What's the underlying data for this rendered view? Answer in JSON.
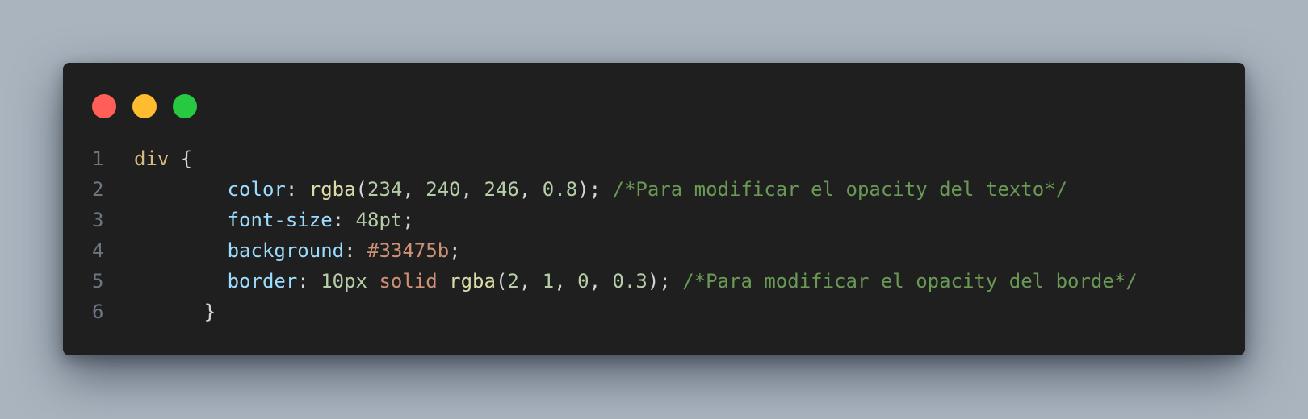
{
  "window": {
    "traffic_lights": [
      {
        "name": "close",
        "color": "#ff5f57"
      },
      {
        "name": "minimize",
        "color": "#febc2e"
      },
      {
        "name": "maximize",
        "color": "#28c840"
      }
    ]
  },
  "code": {
    "lines": [
      {
        "number": "1",
        "indent": "",
        "tokens": [
          {
            "type": "selector",
            "text": "div"
          },
          {
            "type": "brace",
            "text": " {"
          }
        ]
      },
      {
        "number": "2",
        "indent": "        ",
        "tokens": [
          {
            "type": "prop",
            "text": "color"
          },
          {
            "type": "punct",
            "text": ": "
          },
          {
            "type": "func",
            "text": "rgba"
          },
          {
            "type": "punct",
            "text": "("
          },
          {
            "type": "num",
            "text": "234"
          },
          {
            "type": "punct",
            "text": ", "
          },
          {
            "type": "num",
            "text": "240"
          },
          {
            "type": "punct",
            "text": ", "
          },
          {
            "type": "num",
            "text": "246"
          },
          {
            "type": "punct",
            "text": ", "
          },
          {
            "type": "num",
            "text": "0.8"
          },
          {
            "type": "punct",
            "text": "); "
          },
          {
            "type": "comment",
            "text": "/*Para modificar el opacity del texto*/"
          }
        ]
      },
      {
        "number": "3",
        "indent": "        ",
        "tokens": [
          {
            "type": "prop",
            "text": "font-size"
          },
          {
            "type": "punct",
            "text": ": "
          },
          {
            "type": "num",
            "text": "48pt"
          },
          {
            "type": "punct",
            "text": ";"
          }
        ]
      },
      {
        "number": "4",
        "indent": "        ",
        "tokens": [
          {
            "type": "prop",
            "text": "background"
          },
          {
            "type": "punct",
            "text": ": "
          },
          {
            "type": "str",
            "text": "#33475b"
          },
          {
            "type": "punct",
            "text": ";"
          }
        ]
      },
      {
        "number": "5",
        "indent": "        ",
        "tokens": [
          {
            "type": "prop",
            "text": "border"
          },
          {
            "type": "punct",
            "text": ": "
          },
          {
            "type": "num",
            "text": "10px"
          },
          {
            "type": "punct",
            "text": " "
          },
          {
            "type": "str",
            "text": "solid"
          },
          {
            "type": "punct",
            "text": " "
          },
          {
            "type": "func",
            "text": "rgba"
          },
          {
            "type": "punct",
            "text": "("
          },
          {
            "type": "num",
            "text": "2"
          },
          {
            "type": "punct",
            "text": ", "
          },
          {
            "type": "num",
            "text": "1"
          },
          {
            "type": "punct",
            "text": ", "
          },
          {
            "type": "num",
            "text": "0"
          },
          {
            "type": "punct",
            "text": ", "
          },
          {
            "type": "num",
            "text": "0.3"
          },
          {
            "type": "punct",
            "text": "); "
          },
          {
            "type": "comment",
            "text": "/*Para modificar el opacity del borde*/"
          }
        ]
      },
      {
        "number": "6",
        "indent": "      ",
        "tokens": [
          {
            "type": "brace",
            "text": "}"
          }
        ]
      }
    ]
  }
}
